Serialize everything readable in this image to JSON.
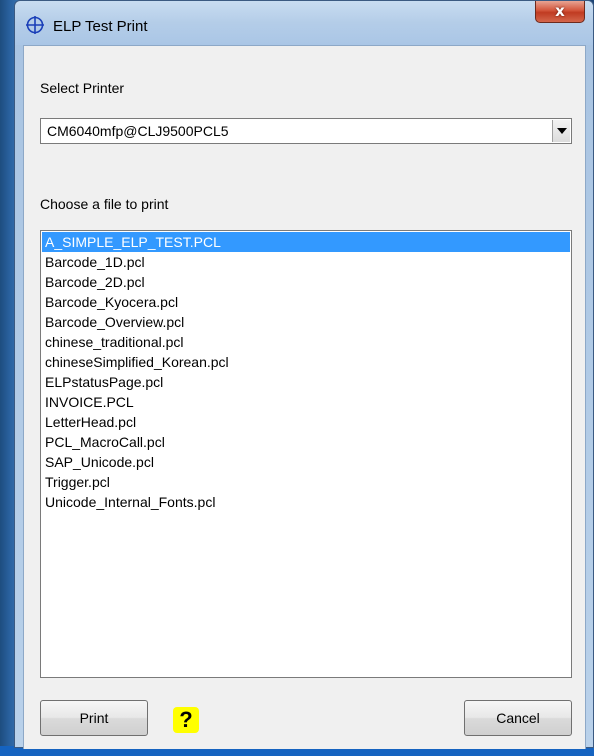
{
  "window": {
    "title": "ELP Test Print",
    "close_label": "x"
  },
  "printer": {
    "label": "Select Printer",
    "selected": "CM6040mfp@CLJ9500PCL5"
  },
  "files": {
    "label": "Choose a file to print",
    "items": [
      {
        "name": "A_SIMPLE_ELP_TEST.PCL",
        "selected": true
      },
      {
        "name": "Barcode_1D.pcl",
        "selected": false
      },
      {
        "name": "Barcode_2D.pcl",
        "selected": false
      },
      {
        "name": "Barcode_Kyocera.pcl",
        "selected": false
      },
      {
        "name": "Barcode_Overview.pcl",
        "selected": false
      },
      {
        "name": "chinese_traditional.pcl",
        "selected": false
      },
      {
        "name": "chineseSimplified_Korean.pcl",
        "selected": false
      },
      {
        "name": "ELPstatusPage.pcl",
        "selected": false
      },
      {
        "name": "INVOICE.PCL",
        "selected": false
      },
      {
        "name": "LetterHead.pcl",
        "selected": false
      },
      {
        "name": "PCL_MacroCall.pcl",
        "selected": false
      },
      {
        "name": "SAP_Unicode.pcl",
        "selected": false
      },
      {
        "name": "Trigger.pcl",
        "selected": false
      },
      {
        "name": "Unicode_Internal_Fonts.pcl",
        "selected": false
      }
    ]
  },
  "buttons": {
    "print": "Print",
    "help": "?",
    "cancel": "Cancel"
  },
  "colors": {
    "selection": "#3399ff",
    "help_background": "#ffff00",
    "close_button": "#c03b22"
  },
  "icons": {
    "title": "crosshair-icon",
    "dropdown": "chevron-down-icon"
  }
}
